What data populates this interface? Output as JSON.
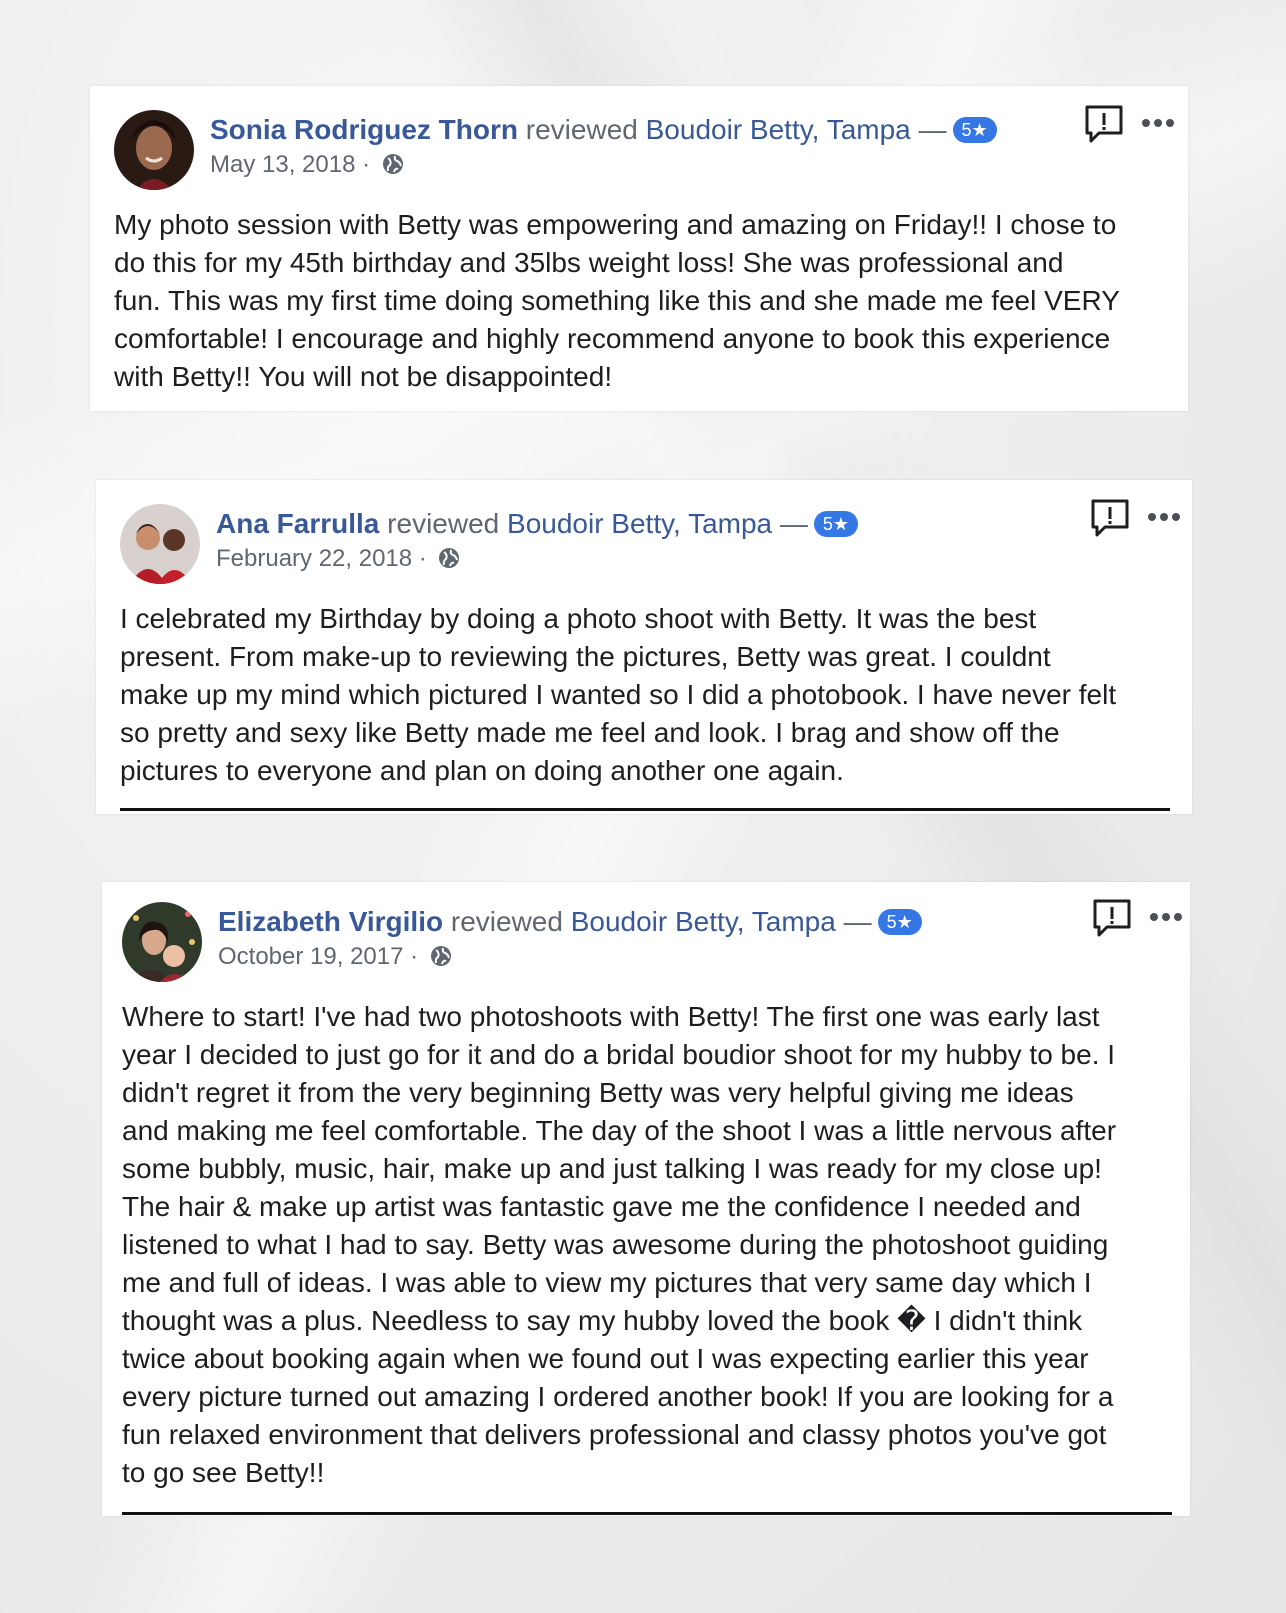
{
  "reviews": [
    {
      "name": "Sonia Rodriguez Thorn",
      "verb": "reviewed",
      "page": "Boudoir Betty, Tampa",
      "dash": "—",
      "rating": "5★",
      "date": "May 13, 2018 ·",
      "text": "My photo session with Betty was empowering and amazing on Friday!! I chose to\ndo this for my 45th birthday and 35lbs weight loss! She was professional and\nfun. This was my first time doing something like this and she made me feel VERY\ncomfortable! I encourage and highly recommend anyone to book this experience\nwith Betty!! You will not be disappointed!"
    },
    {
      "name": "Ana Farrulla",
      "verb": "reviewed",
      "page": "Boudoir Betty, Tampa",
      "dash": "—",
      "rating": "5★",
      "date": "February 22, 2018 ·",
      "text": "I celebrated my Birthday by doing a photo shoot with Betty. It was the best\npresent. From make-up to reviewing the pictures, Betty was great. I couldnt\nmake up my mind which pictured I wanted so I did a photobook. I have never felt\nso pretty and sexy like Betty made me feel and look. I brag and show off the\npictures to everyone and plan on doing another one again."
    },
    {
      "name": "Elizabeth Virgilio",
      "verb": "reviewed",
      "page": "Boudoir Betty, Tampa",
      "dash": "—",
      "rating": "5★",
      "date": "October 19, 2017 ·",
      "text": "Where to start! I've had two photoshoots with Betty! The first one was early last\nyear I decided to just go for it and do a bridal boudior shoot for my hubby to be. I\ndidn't regret it from the very beginning Betty was very helpful giving me ideas\nand making me feel comfortable. The day of the shoot I was a little nervous after\nsome bubbly, music, hair, make up and just talking I was ready for my close up!\nThe hair & make up artist was fantastic gave me the confidence I needed and\nlistened to what I had to say. Betty was awesome during the photoshoot guiding\nme and full of ideas. I was able to view my pictures that very same day which I\nthought was a plus. Needless to say my hubby loved the book � I didn't think\ntwice about booking again when we found out I was expecting earlier this year\nevery picture turned out amazing I ordered another book! If you are looking for a\nfun relaxed environment that delivers professional and classy photos you've got\nto go see Betty!!"
    }
  ],
  "icons": {
    "report": "report-icon",
    "more": "more-options-icon",
    "privacy": "globe-icon"
  },
  "colors": {
    "link": "#385898",
    "meta": "#606770",
    "badge": "#3578e5",
    "text": "#1c1e21"
  }
}
